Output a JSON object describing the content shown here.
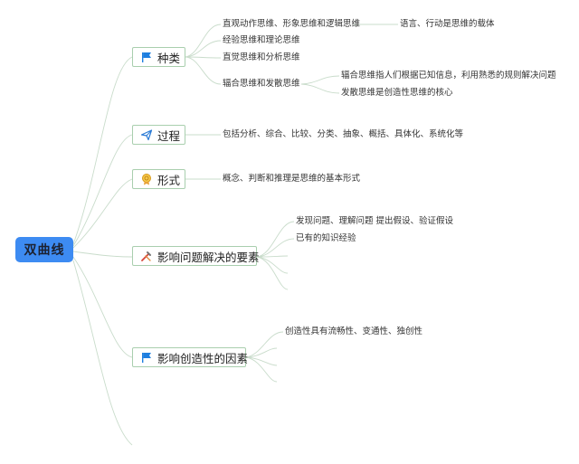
{
  "root": {
    "label": "双曲线"
  },
  "topics": [
    {
      "id": "kinds",
      "label": "种类",
      "icon": "blue-flag-icon",
      "children": [
        {
          "text": "直观动作思维、形象思维和逻辑思维",
          "children": [
            {
              "text": "语言、行动是思维的载体"
            }
          ]
        },
        {
          "text": "经验思维和理论思维"
        },
        {
          "text": "直觉思维和分析思维"
        },
        {
          "text": "辐合思维和发散思维",
          "children": [
            {
              "text": "辐合思维指人们根据已知信息，利用熟悉的规则解决问题"
            },
            {
              "text": "发散思维是创造性思维的核心"
            }
          ]
        }
      ]
    },
    {
      "id": "process",
      "label": "过程",
      "icon": "paper-plane-icon",
      "children": [
        {
          "text": "包括分析、综合、比较、分类、抽象、概括、具体化、系统化等"
        }
      ]
    },
    {
      "id": "form",
      "label": "形式",
      "icon": "medal-icon",
      "children": [
        {
          "text": "概念、判断和推理是思维的基本形式"
        }
      ]
    },
    {
      "id": "factors",
      "label": "影响问题解决的要素",
      "icon": "tools-icon",
      "children": [
        {
          "text": "发现问题、理解问题 提出假设、验证假设"
        },
        {
          "text": "已有的知识经验"
        }
      ]
    },
    {
      "id": "creativity",
      "label": "影响创造性的因素",
      "icon": "blue-flag-icon",
      "children": [
        {
          "text": "创造性具有流畅性、变通性、独创性"
        }
      ]
    }
  ],
  "colors": {
    "root_fill": "#3d8bf2",
    "topic_border": "#a9cfae",
    "line": "#c4d9c8",
    "flag": "#1f7fe0"
  }
}
